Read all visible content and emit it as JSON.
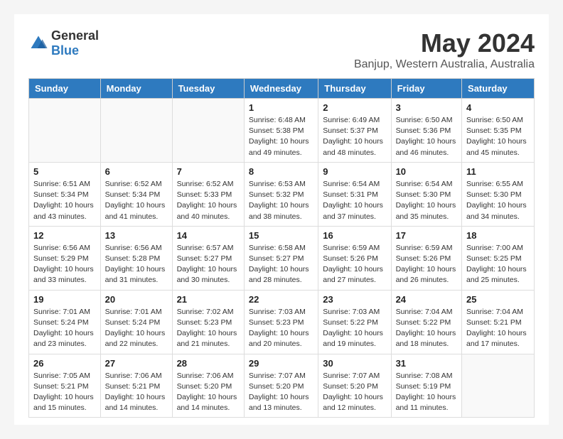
{
  "logo": {
    "general": "General",
    "blue": "Blue"
  },
  "title": "May 2024",
  "subtitle": "Banjup, Western Australia, Australia",
  "weekdays": [
    "Sunday",
    "Monday",
    "Tuesday",
    "Wednesday",
    "Thursday",
    "Friday",
    "Saturday"
  ],
  "weeks": [
    [
      {
        "day": "",
        "info": ""
      },
      {
        "day": "",
        "info": ""
      },
      {
        "day": "",
        "info": ""
      },
      {
        "day": "1",
        "info": "Sunrise: 6:48 AM\nSunset: 5:38 PM\nDaylight: 10 hours\nand 49 minutes."
      },
      {
        "day": "2",
        "info": "Sunrise: 6:49 AM\nSunset: 5:37 PM\nDaylight: 10 hours\nand 48 minutes."
      },
      {
        "day": "3",
        "info": "Sunrise: 6:50 AM\nSunset: 5:36 PM\nDaylight: 10 hours\nand 46 minutes."
      },
      {
        "day": "4",
        "info": "Sunrise: 6:50 AM\nSunset: 5:35 PM\nDaylight: 10 hours\nand 45 minutes."
      }
    ],
    [
      {
        "day": "5",
        "info": "Sunrise: 6:51 AM\nSunset: 5:34 PM\nDaylight: 10 hours\nand 43 minutes."
      },
      {
        "day": "6",
        "info": "Sunrise: 6:52 AM\nSunset: 5:34 PM\nDaylight: 10 hours\nand 41 minutes."
      },
      {
        "day": "7",
        "info": "Sunrise: 6:52 AM\nSunset: 5:33 PM\nDaylight: 10 hours\nand 40 minutes."
      },
      {
        "day": "8",
        "info": "Sunrise: 6:53 AM\nSunset: 5:32 PM\nDaylight: 10 hours\nand 38 minutes."
      },
      {
        "day": "9",
        "info": "Sunrise: 6:54 AM\nSunset: 5:31 PM\nDaylight: 10 hours\nand 37 minutes."
      },
      {
        "day": "10",
        "info": "Sunrise: 6:54 AM\nSunset: 5:30 PM\nDaylight: 10 hours\nand 35 minutes."
      },
      {
        "day": "11",
        "info": "Sunrise: 6:55 AM\nSunset: 5:30 PM\nDaylight: 10 hours\nand 34 minutes."
      }
    ],
    [
      {
        "day": "12",
        "info": "Sunrise: 6:56 AM\nSunset: 5:29 PM\nDaylight: 10 hours\nand 33 minutes."
      },
      {
        "day": "13",
        "info": "Sunrise: 6:56 AM\nSunset: 5:28 PM\nDaylight: 10 hours\nand 31 minutes."
      },
      {
        "day": "14",
        "info": "Sunrise: 6:57 AM\nSunset: 5:27 PM\nDaylight: 10 hours\nand 30 minutes."
      },
      {
        "day": "15",
        "info": "Sunrise: 6:58 AM\nSunset: 5:27 PM\nDaylight: 10 hours\nand 28 minutes."
      },
      {
        "day": "16",
        "info": "Sunrise: 6:59 AM\nSunset: 5:26 PM\nDaylight: 10 hours\nand 27 minutes."
      },
      {
        "day": "17",
        "info": "Sunrise: 6:59 AM\nSunset: 5:26 PM\nDaylight: 10 hours\nand 26 minutes."
      },
      {
        "day": "18",
        "info": "Sunrise: 7:00 AM\nSunset: 5:25 PM\nDaylight: 10 hours\nand 25 minutes."
      }
    ],
    [
      {
        "day": "19",
        "info": "Sunrise: 7:01 AM\nSunset: 5:24 PM\nDaylight: 10 hours\nand 23 minutes."
      },
      {
        "day": "20",
        "info": "Sunrise: 7:01 AM\nSunset: 5:24 PM\nDaylight: 10 hours\nand 22 minutes."
      },
      {
        "day": "21",
        "info": "Sunrise: 7:02 AM\nSunset: 5:23 PM\nDaylight: 10 hours\nand 21 minutes."
      },
      {
        "day": "22",
        "info": "Sunrise: 7:03 AM\nSunset: 5:23 PM\nDaylight: 10 hours\nand 20 minutes."
      },
      {
        "day": "23",
        "info": "Sunrise: 7:03 AM\nSunset: 5:22 PM\nDaylight: 10 hours\nand 19 minutes."
      },
      {
        "day": "24",
        "info": "Sunrise: 7:04 AM\nSunset: 5:22 PM\nDaylight: 10 hours\nand 18 minutes."
      },
      {
        "day": "25",
        "info": "Sunrise: 7:04 AM\nSunset: 5:21 PM\nDaylight: 10 hours\nand 17 minutes."
      }
    ],
    [
      {
        "day": "26",
        "info": "Sunrise: 7:05 AM\nSunset: 5:21 PM\nDaylight: 10 hours\nand 15 minutes."
      },
      {
        "day": "27",
        "info": "Sunrise: 7:06 AM\nSunset: 5:21 PM\nDaylight: 10 hours\nand 14 minutes."
      },
      {
        "day": "28",
        "info": "Sunrise: 7:06 AM\nSunset: 5:20 PM\nDaylight: 10 hours\nand 14 minutes."
      },
      {
        "day": "29",
        "info": "Sunrise: 7:07 AM\nSunset: 5:20 PM\nDaylight: 10 hours\nand 13 minutes."
      },
      {
        "day": "30",
        "info": "Sunrise: 7:07 AM\nSunset: 5:20 PM\nDaylight: 10 hours\nand 12 minutes."
      },
      {
        "day": "31",
        "info": "Sunrise: 7:08 AM\nSunset: 5:19 PM\nDaylight: 10 hours\nand 11 minutes."
      },
      {
        "day": "",
        "info": ""
      }
    ]
  ]
}
